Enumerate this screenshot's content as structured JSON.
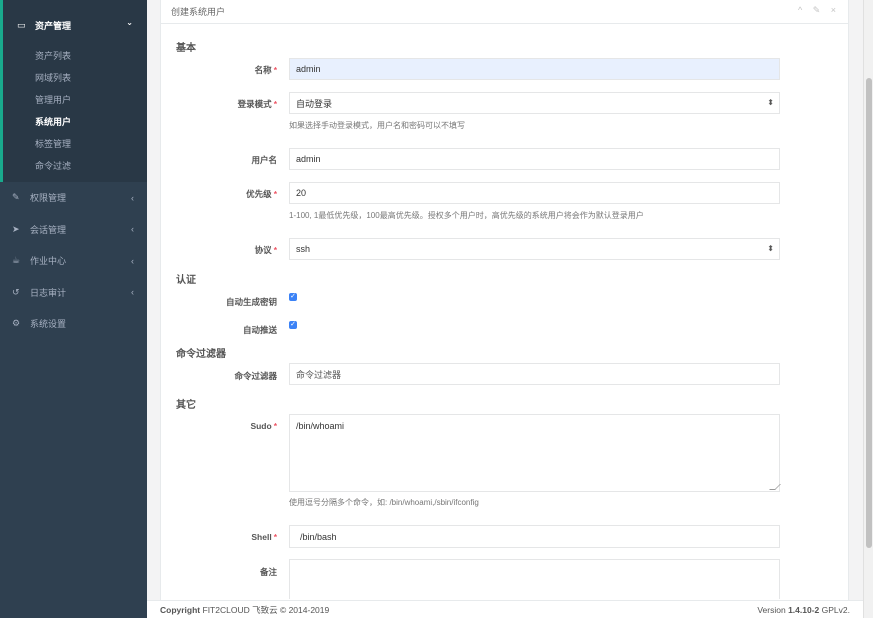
{
  "sidebar": {
    "asset_section": {
      "title": "资产管理",
      "items": [
        "资产列表",
        "网域列表",
        "管理用户",
        "系统用户",
        "标签管理",
        "命令过滤"
      ],
      "active_index": 3
    },
    "menu": [
      {
        "label": "权限管理",
        "icon": "edit-icon"
      },
      {
        "label": "会话管理",
        "icon": "paper-plane-icon"
      },
      {
        "label": "作业中心",
        "icon": "coffee-icon"
      },
      {
        "label": "日志审计",
        "icon": "history-icon"
      },
      {
        "label": "系统设置",
        "icon": "gears-icon"
      }
    ]
  },
  "panel": {
    "title": "创建系统用户",
    "tools": "^ ✎ ×"
  },
  "form": {
    "sec_basic": "基本",
    "name_label": "名称",
    "name_value": "admin",
    "login_mode_label": "登录模式",
    "login_mode_value": "自动登录",
    "login_mode_help": "如果选择手动登录模式，用户名和密码可以不填写",
    "username_label": "用户名",
    "username_value": "admin",
    "priority_label": "优先级",
    "priority_value": "20",
    "priority_help": "1-100, 1最低优先级，100最高优先级。授权多个用户时，高优先级的系统用户将会作为默认登录用户",
    "protocol_label": "协议",
    "protocol_value": "ssh",
    "sec_auth": "认证",
    "auto_gen_key_label": "自动生成密钥",
    "auto_push_label": "自动推送",
    "sec_cmd_filter": "命令过滤器",
    "cmd_filter_label": "命令过滤器",
    "cmd_filter_value": "命令过滤器",
    "sec_other": "其它",
    "sudo_label": "Sudo",
    "sudo_value": "/bin/whoami",
    "sudo_help": "使用逗号分隔多个命令，如: /bin/whoami,/sbin/ifconfig",
    "shell_label": "Shell",
    "shell_value": "/bin/bash",
    "comment_label": "备注",
    "required_mark": "*"
  },
  "footer": {
    "copyright_bold": "Copyright",
    "copyright_rest": " FIT2CLOUD 飞致云 © 2014-2019",
    "version_prefix": "Version ",
    "version_bold": "1.4.10-2",
    "version_suffix": " GPLv2."
  }
}
